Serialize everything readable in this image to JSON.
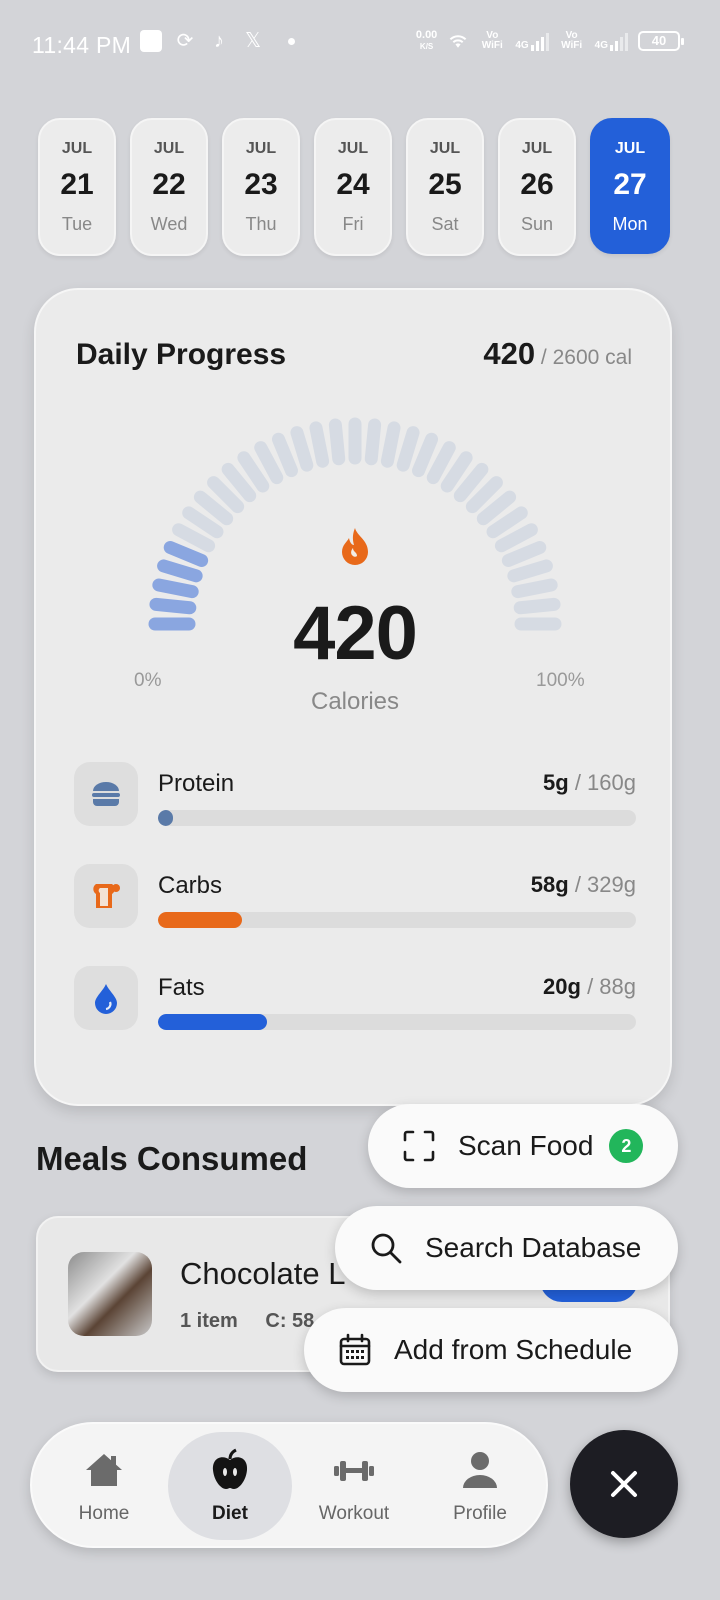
{
  "status_bar": {
    "time": "11:44 PM",
    "speed_value": "0.00",
    "speed_unit": "K/S",
    "net1": "Vo WiFi",
    "net1_gen": "4G",
    "net2": "Vo WiFi",
    "net2_gen": "4G",
    "battery": "40"
  },
  "dates": [
    {
      "month": "JUL",
      "day": "21",
      "weekday": "Tue"
    },
    {
      "month": "JUL",
      "day": "22",
      "weekday": "Wed"
    },
    {
      "month": "JUL",
      "day": "23",
      "weekday": "Thu"
    },
    {
      "month": "JUL",
      "day": "24",
      "weekday": "Fri"
    },
    {
      "month": "JUL",
      "day": "25",
      "weekday": "Sat"
    },
    {
      "month": "JUL",
      "day": "26",
      "weekday": "Sun"
    },
    {
      "month": "JUL",
      "day": "27",
      "weekday": "Mon"
    }
  ],
  "selected_date_index": 6,
  "progress": {
    "title": "Daily Progress",
    "consumed": "420",
    "goal_text": "/ 2600 cal",
    "big_value": "420",
    "big_label": "Calories",
    "min_label": "0%",
    "max_label": "100%",
    "fraction": 0.16
  },
  "macros": [
    {
      "name": "Protein",
      "value": "5g",
      "goal": "/ 160g",
      "fraction": 0.031,
      "color": "#5a7aa8",
      "icon": "burger-icon"
    },
    {
      "name": "Carbs",
      "value": "58g",
      "goal": "/ 329g",
      "fraction": 0.176,
      "color": "#e8691a",
      "icon": "bread-icon"
    },
    {
      "name": "Fats",
      "value": "20g",
      "goal": "/ 88g",
      "fraction": 0.227,
      "color": "#2360d9",
      "icon": "drop-icon"
    }
  ],
  "meals": {
    "title": "Meals Consumed",
    "items": [
      {
        "name": "Chocolate L",
        "meta_items": "1 item",
        "meta_carbs": "C: 58"
      }
    ]
  },
  "fab_menu": {
    "scan_label": "Scan Food",
    "scan_badge": "2",
    "search_label": "Search Database",
    "schedule_label": "Add from Schedule"
  },
  "nav": {
    "home": "Home",
    "diet": "Diet",
    "workout": "Workout",
    "profile": "Profile"
  },
  "colors": {
    "accent": "#2360d9",
    "gauge_filled": "#8aa6e0",
    "gauge_empty": "#d6dbe3",
    "flame": "#e8691a"
  }
}
